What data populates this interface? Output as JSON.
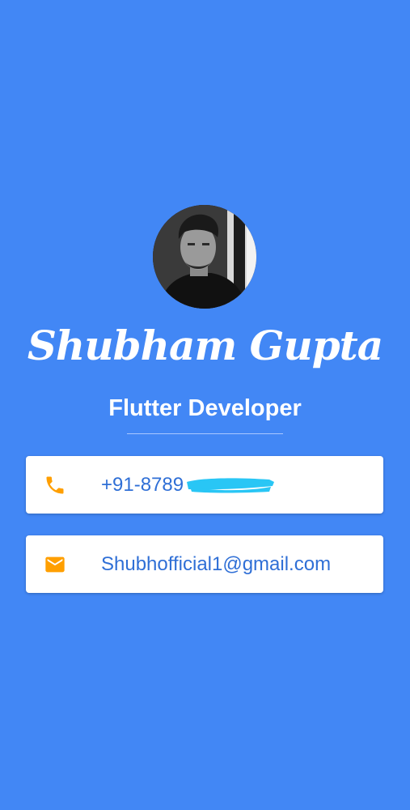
{
  "profile": {
    "name": "Shubham Gupta",
    "title": "Flutter Developer",
    "avatar": "profile-photo"
  },
  "contacts": {
    "phone": {
      "icon": "phone-icon",
      "text": "+91-8789"
    },
    "email": {
      "icon": "mail-icon",
      "text": "Shubhofficial1@gmail.com"
    }
  },
  "colors": {
    "background": "#4287f5",
    "card": "#ffffff",
    "accent_icon": "#ff9f00",
    "contact_text": "#2f6fd6",
    "redaction": "#29c6f5"
  }
}
